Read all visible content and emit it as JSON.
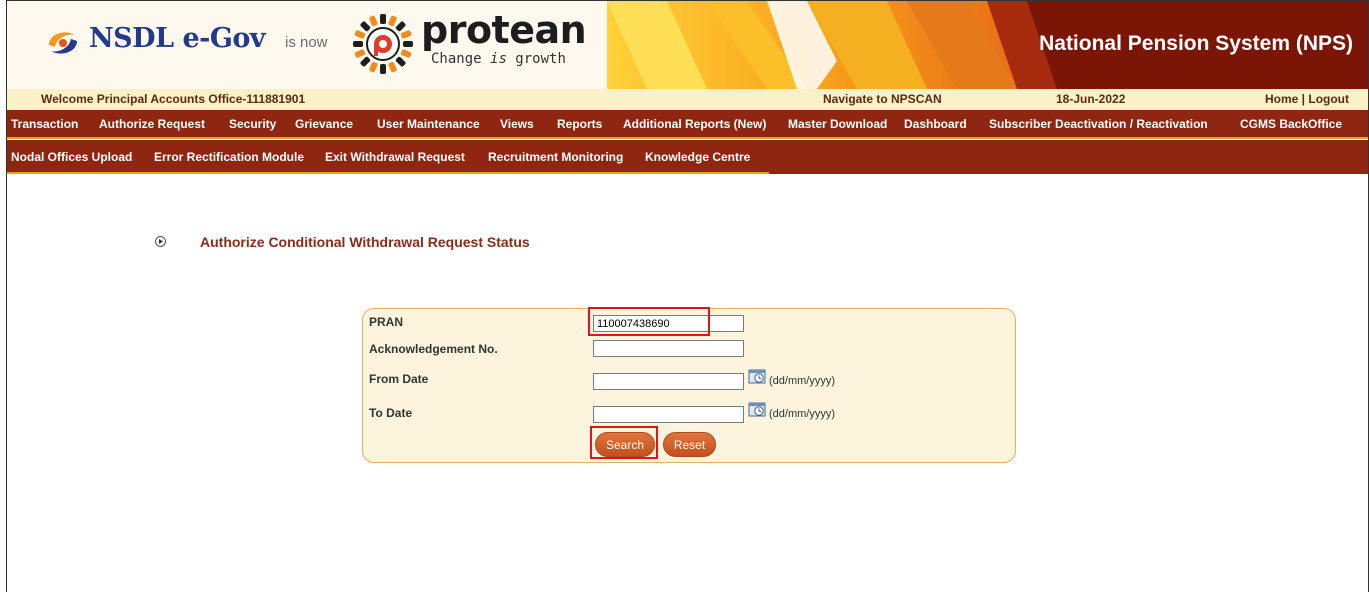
{
  "header": {
    "nsdl_brand": "NSDL e-Gov",
    "is_now": "is now",
    "protean_brand": "protean",
    "tagline_pre": "Change ",
    "tagline_is": "is",
    "tagline_post": " growth",
    "system_title": "National Pension System (NPS)"
  },
  "welcome_bar": {
    "welcome": "Welcome Principal Accounts Office-111881901",
    "navigate": "Navigate to NPSCAN",
    "date": "18-Jun-2022",
    "home_logout": "Home | Logout"
  },
  "menu_primary": [
    "Transaction",
    "Authorize Request",
    "Security",
    "Grievance",
    "User Maintenance",
    "Views",
    "Reports",
    "Additional Reports (New)",
    "Master Download",
    "Dashboard",
    "Subscriber Deactivation / Reactivation",
    "CGMS BackOffice"
  ],
  "menu_secondary": [
    "Nodal Offices Upload",
    "Error Rectification Module",
    "Exit Withdrawal Request",
    "Recruitment Monitoring",
    "Knowledge Centre"
  ],
  "page": {
    "title": "Authorize Conditional Withdrawal Request Status"
  },
  "form": {
    "pran_label": "PRAN",
    "pran_value": "110007438690",
    "ack_label": "Acknowledgement No.",
    "ack_value": "",
    "from_label": "From Date",
    "from_value": "",
    "to_label": "To Date",
    "to_value": "",
    "date_format": "(dd/mm/yyyy)",
    "search_label": "Search",
    "reset_label": "Reset"
  },
  "colors": {
    "menu_bg": "#8f2611",
    "menu_accent": "#e3a51f",
    "welcome_bg": "#fbf1c8",
    "panel_bg": "#fcf4dc",
    "button": "#d0612b",
    "highlight": "#e0141e"
  }
}
